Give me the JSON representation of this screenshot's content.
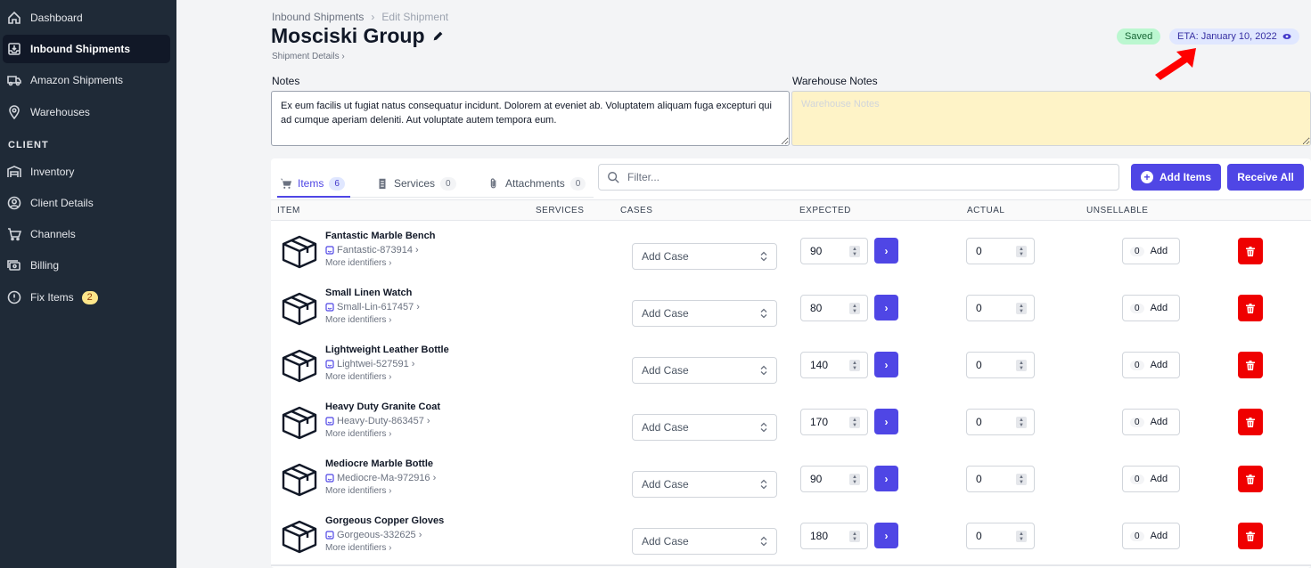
{
  "sidebar": {
    "items": [
      {
        "label": "Dashboard",
        "icon": "home-icon"
      },
      {
        "label": "Inbound Shipments",
        "icon": "inbox-icon",
        "active": true
      },
      {
        "label": "Amazon Shipments",
        "icon": "truck-icon"
      },
      {
        "label": "Warehouses",
        "icon": "location-pin-icon"
      }
    ],
    "section_label": "CLIENT",
    "client_items": [
      {
        "label": "Inventory",
        "icon": "warehouse-icon"
      },
      {
        "label": "Client Details",
        "icon": "user-circle-icon"
      },
      {
        "label": "Channels",
        "icon": "cart-icon"
      },
      {
        "label": "Billing",
        "icon": "billing-icon"
      },
      {
        "label": "Fix Items",
        "icon": "alert-circle-icon",
        "badge": "2"
      }
    ]
  },
  "header": {
    "breadcrumb": [
      "Inbound Shipments",
      "Edit Shipment"
    ],
    "title": "Mosciski Group",
    "sub_link": "Shipment Details ›",
    "saved_badge": "Saved",
    "eta": "ETA: January 10, 2022"
  },
  "notes": {
    "label": "Notes",
    "value": "Ex eum facilis ut fugiat natus consequatur incidunt. Dolorem at eveniet ab. Voluptatem aliquam fuga excepturi qui ad cumque aperiam deleniti. Aut voluptate autem tempora eum.",
    "warehouse_label": "Warehouse Notes",
    "warehouse_placeholder": "Warehouse Notes"
  },
  "tabs": [
    {
      "label": "Items",
      "count": "6",
      "active": true
    },
    {
      "label": "Services",
      "count": "0"
    },
    {
      "label": "Attachments",
      "count": "0"
    }
  ],
  "toolbar": {
    "filter_placeholder": "Filter...",
    "add_items": "Add Items",
    "receive_all": "Receive All"
  },
  "columns": [
    "ITEM",
    "SERVICES",
    "CASES",
    "EXPECTED",
    "ACTUAL",
    "UNSELLABLE"
  ],
  "rows": [
    {
      "name": "Fantastic Marble Bench",
      "sku": "Fantastic-873914",
      "more": "More identifiers ›",
      "case": "Add Case",
      "expected": "90",
      "actual": "0",
      "unsellable": "0",
      "add": "Add"
    },
    {
      "name": "Small Linen Watch",
      "sku": "Small-Lin-617457",
      "more": "More identifiers ›",
      "case": "Add Case",
      "expected": "80",
      "actual": "0",
      "unsellable": "0",
      "add": "Add"
    },
    {
      "name": "Lightweight Leather Bottle",
      "sku": "Lightwei-527591",
      "more": "More identifiers ›",
      "case": "Add Case",
      "expected": "140",
      "actual": "0",
      "unsellable": "0",
      "add": "Add"
    },
    {
      "name": "Heavy Duty Granite Coat",
      "sku": "Heavy-Duty-863457",
      "more": "More identifiers ›",
      "case": "Add Case",
      "expected": "170",
      "actual": "0",
      "unsellable": "0",
      "add": "Add"
    },
    {
      "name": "Mediocre Marble Bottle",
      "sku": "Mediocre-Ma-972916",
      "more": "More identifiers ›",
      "case": "Add Case",
      "expected": "90",
      "actual": "0",
      "unsellable": "0",
      "add": "Add"
    },
    {
      "name": "Gorgeous Copper Gloves",
      "sku": "Gorgeous-332625",
      "more": "More identifiers ›",
      "case": "Add Case",
      "expected": "180",
      "actual": "0",
      "unsellable": "0",
      "add": "Add"
    }
  ],
  "colors": {
    "sidebar": "#1f2a37",
    "accent": "#4f46e5",
    "danger": "#ef0000",
    "arrow": "#ff0000"
  }
}
